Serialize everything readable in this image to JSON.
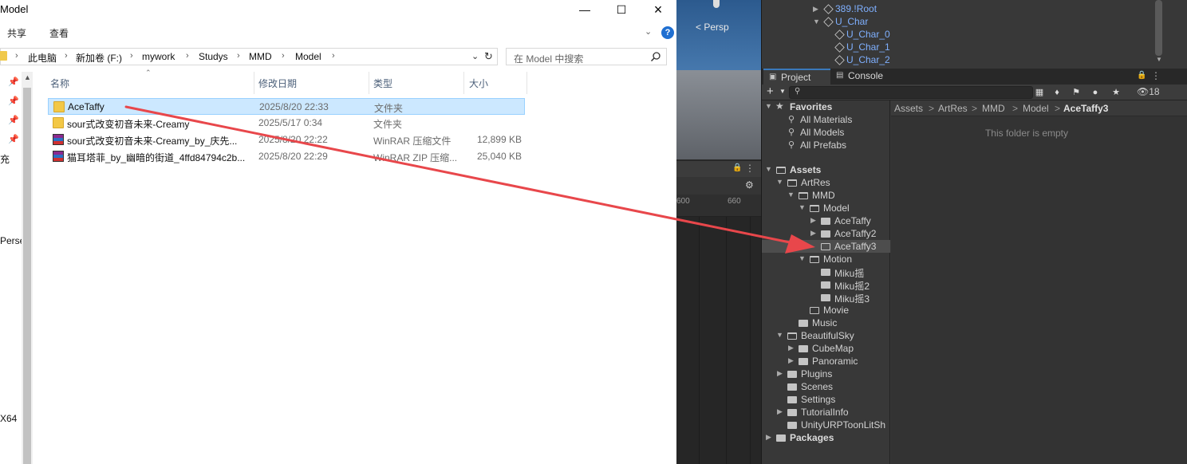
{
  "explorer": {
    "title": "Model",
    "ribbon": {
      "share": "共享",
      "view": "查看"
    },
    "address": [
      "此电脑",
      "新加卷 (F:)",
      "mywork",
      "Studys",
      "MMD",
      "Model"
    ],
    "search_placeholder": "在 Model 中搜索",
    "nav_fragments": [
      "补充",
      "Perse",
      "X64"
    ],
    "columns": {
      "name": "名称",
      "date": "修改日期",
      "type": "类型",
      "size": "大小"
    },
    "files": [
      {
        "name": "AceTaffy",
        "date": "2025/8/20 22:33",
        "type": "文件夹",
        "size": "",
        "icon": "folder-icon",
        "selected": true
      },
      {
        "name": "sour式改变初音未来-Creamy",
        "date": "2025/5/17 0:34",
        "type": "文件夹",
        "size": "",
        "icon": "folder-icon",
        "selected": false
      },
      {
        "name": "sour式改变初音未来-Creamy_by_庆先...",
        "date": "2025/8/20 22:22",
        "type": "WinRAR 压缩文件",
        "size": "12,899 KB",
        "icon": "winrar-icon",
        "selected": false
      },
      {
        "name": "猫耳塔菲_by_幽暗的街道_4ffd84794c2b...",
        "date": "2025/8/20 22:29",
        "type": "WinRAR ZIP 压缩...",
        "size": "25,040 KB",
        "icon": "winrar-zip-icon",
        "selected": false
      }
    ]
  },
  "scene": {
    "persp_label": "< Persp",
    "ruler_ticks": [
      "600",
      "660"
    ]
  },
  "unity": {
    "hierarchy": [
      "389.!Root",
      "U_Char",
      "U_Char_0",
      "U_Char_1",
      "U_Char_2"
    ],
    "tabs": {
      "project": "Project",
      "console": "Console"
    },
    "hidden_count": "18",
    "tree": [
      {
        "label": "Favorites",
        "bold": true
      },
      {
        "label": "All Materials"
      },
      {
        "label": "All Models"
      },
      {
        "label": "All Prefabs"
      },
      {
        "label": "Assets",
        "bold": true
      },
      {
        "label": "ArtRes"
      },
      {
        "label": "MMD"
      },
      {
        "label": "Model"
      },
      {
        "label": "AceTaffy"
      },
      {
        "label": "AceTaffy2"
      },
      {
        "label": "AceTaffy3",
        "selected": true
      },
      {
        "label": "Motion"
      },
      {
        "label": "Miku摇"
      },
      {
        "label": "Miku摇2"
      },
      {
        "label": "Miku摇3"
      },
      {
        "label": "Movie"
      },
      {
        "label": "Music"
      },
      {
        "label": "BeautifulSky"
      },
      {
        "label": "CubeMap"
      },
      {
        "label": "Panoramic"
      },
      {
        "label": "Plugins"
      },
      {
        "label": "Scenes"
      },
      {
        "label": "Settings"
      },
      {
        "label": "TutorialInfo"
      },
      {
        "label": "UnityURPToonLitSh"
      },
      {
        "label": "Packages",
        "bold": true
      }
    ],
    "breadcrumb": [
      "Assets",
      "ArtRes",
      "MMD",
      "Model",
      "AceTaffy3"
    ],
    "empty_message": "This folder is empty"
  },
  "colors": {
    "arrow": "#e8474b",
    "selection": "#cce8ff",
    "link_blue": "#7fb0ff"
  }
}
